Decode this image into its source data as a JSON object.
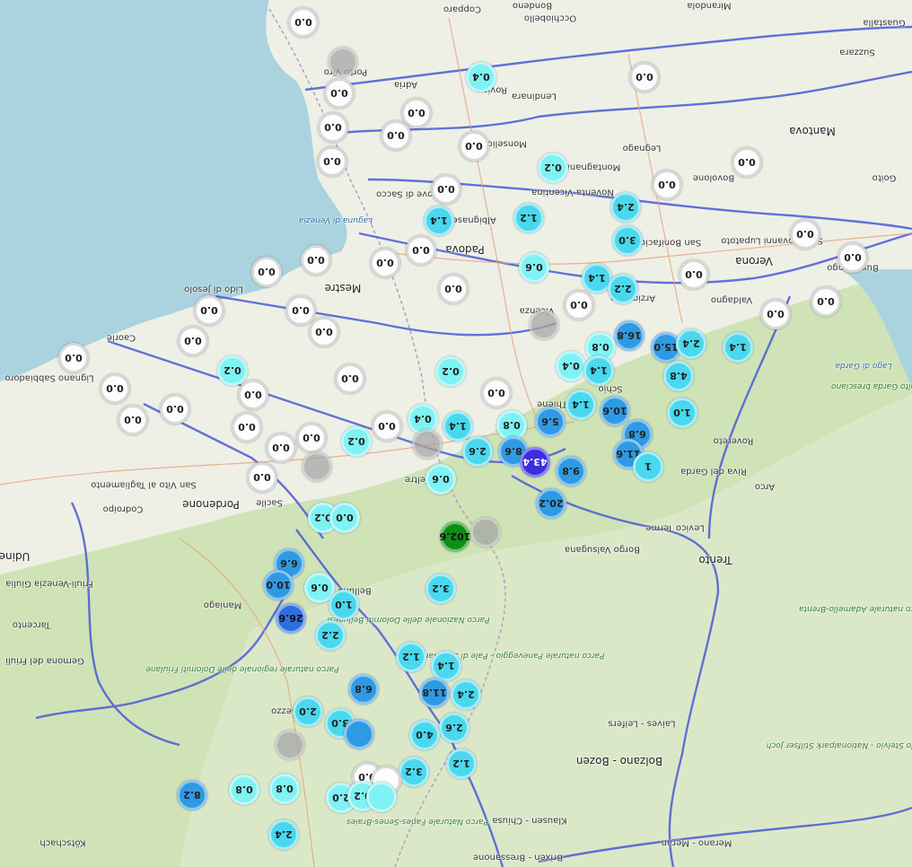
{
  "map": {
    "place_labels": [
      {
        "text": "Copparo",
        "big": false
      },
      {
        "text": "Bondeno",
        "big": false
      },
      {
        "text": "Mirandola",
        "big": false
      },
      {
        "text": "Occhiobello",
        "big": false
      },
      {
        "text": "Guastalla",
        "big": false
      },
      {
        "text": "Suzzara",
        "big": false
      },
      {
        "text": "Porto Viro",
        "big": false
      },
      {
        "text": "Adria",
        "big": false
      },
      {
        "text": "Rovigo",
        "big": false
      },
      {
        "text": "Lendinara",
        "big": false
      },
      {
        "text": "Mantova",
        "big": true
      },
      {
        "text": "Legnago",
        "big": false
      },
      {
        "text": "Monselice",
        "big": false
      },
      {
        "text": "Montagnana",
        "big": false
      },
      {
        "text": "Bovolone",
        "big": false
      },
      {
        "text": "Goito",
        "big": false
      },
      {
        "text": "Piove di Sacco",
        "big": false
      },
      {
        "text": "Noventa Vicentina",
        "big": false
      },
      {
        "text": "Albignasego",
        "big": false
      },
      {
        "text": "San Bonifacio",
        "big": false
      },
      {
        "text": "San Giovanni Lupatoto",
        "big": false
      },
      {
        "text": "Padova",
        "big": true
      },
      {
        "text": "Verona",
        "big": true
      },
      {
        "text": "Bussolengo",
        "big": false
      },
      {
        "text": "Lido di Jesolo",
        "big": false
      },
      {
        "text": "Mestre",
        "big": true
      },
      {
        "text": "Vicenza",
        "big": false
      },
      {
        "text": "Arzignano",
        "big": false
      },
      {
        "text": "Valdagno",
        "big": false
      },
      {
        "text": "Schio",
        "big": false
      },
      {
        "text": "Thiene",
        "big": false
      },
      {
        "text": "Rovereto",
        "big": false
      },
      {
        "text": "Riva del Garda",
        "big": false
      },
      {
        "text": "Arco",
        "big": false
      },
      {
        "text": "Pordenone",
        "big": true
      },
      {
        "text": "Udine",
        "big": true
      },
      {
        "text": "Codroipo",
        "big": false
      },
      {
        "text": "San Vito al Tagliamento",
        "big": false
      },
      {
        "text": "Lignano Sabbiadoro",
        "big": false
      },
      {
        "text": "Caorle",
        "big": false
      },
      {
        "text": "Sacile",
        "big": false
      },
      {
        "text": "Feltre",
        "big": false
      },
      {
        "text": "Belluno",
        "big": false
      },
      {
        "text": "Levico Terme",
        "big": false
      },
      {
        "text": "Borgo Valsugana",
        "big": false
      },
      {
        "text": "Trento",
        "big": true
      },
      {
        "text": "Bolzano - Bozen",
        "big": true
      },
      {
        "text": "Laives - Leifers",
        "big": false
      },
      {
        "text": "Merano - Meran",
        "big": false
      },
      {
        "text": "Klausen - Chiusa",
        "big": false
      },
      {
        "text": "Brixen - Bressanone",
        "big": false
      },
      {
        "text": "Tolmezzo",
        "big": false
      },
      {
        "text": "Gemona del Friuli",
        "big": false
      },
      {
        "text": "Tarcento",
        "big": false
      },
      {
        "text": "Maniago",
        "big": false
      },
      {
        "text": "Friuli-Venezia Giulia",
        "big": false
      },
      {
        "text": "Kötschach",
        "big": false
      }
    ],
    "park_labels": [
      "Parco Nazionale delle Dolomiti Bellunesi",
      "Parco naturale regionale delle Dolomiti Friulane",
      "Parco naturale Paneveggio - Pale di San Martino",
      "Parco Naturale Fanes-Senes-Braies",
      "Parco naturale Adamello-Brenta",
      "Parco Nazionale dello Stelvio - Nationalpark Stilfser Joch",
      "Parco alto Garda bresciano"
    ],
    "water_labels": [
      "Laguna di Venezia",
      "Lago di Garda"
    ],
    "markers": [
      {
        "value": "0.0",
        "level": "zero"
      },
      {
        "value": "0.4",
        "level": "low"
      },
      {
        "value": "0.0",
        "level": "zero"
      },
      {
        "value": "",
        "level": "grey"
      },
      {
        "value": "0.0",
        "level": "zero"
      },
      {
        "value": "0.0",
        "level": "zero"
      },
      {
        "value": "0.0",
        "level": "zero"
      },
      {
        "value": "0.0",
        "level": "zero"
      },
      {
        "value": "0.0",
        "level": "zero"
      },
      {
        "value": "0.2",
        "level": "low"
      },
      {
        "value": "0.0",
        "level": "zero"
      },
      {
        "value": "0.0",
        "level": "zero"
      },
      {
        "value": "0.0",
        "level": "zero"
      },
      {
        "value": "0.0",
        "level": "zero"
      },
      {
        "value": "1.2",
        "level": "mid"
      },
      {
        "value": "2.4",
        "level": "mid"
      },
      {
        "value": "1.4",
        "level": "mid"
      },
      {
        "value": "0.0",
        "level": "zero"
      },
      {
        "value": "3.0",
        "level": "mid"
      },
      {
        "value": "0.0",
        "level": "zero"
      },
      {
        "value": "0.0",
        "level": "zero"
      },
      {
        "value": "0.0",
        "level": "zero"
      },
      {
        "value": "0.0",
        "level": "zero"
      },
      {
        "value": "0.0",
        "level": "zero"
      },
      {
        "value": "0.6",
        "level": "low"
      },
      {
        "value": "0.0",
        "level": "zero"
      },
      {
        "value": "1.4",
        "level": "mid"
      },
      {
        "value": "2.2",
        "level": "mid"
      },
      {
        "value": "0.0",
        "level": "zero"
      },
      {
        "value": "0.0",
        "level": "zero"
      },
      {
        "value": "0.0",
        "level": "zero"
      },
      {
        "value": "0.0",
        "level": "zero"
      },
      {
        "value": "",
        "level": "grey"
      },
      {
        "value": "0.0",
        "level": "zero"
      },
      {
        "value": "0.0",
        "level": "zero"
      },
      {
        "value": "0.0",
        "level": "zero"
      },
      {
        "value": "16.8",
        "level": "high"
      },
      {
        "value": "0.8",
        "level": "low"
      },
      {
        "value": "15.0",
        "level": "high"
      },
      {
        "value": "2.4",
        "level": "mid"
      },
      {
        "value": "1.4",
        "level": "mid"
      },
      {
        "value": "0.0",
        "level": "zero"
      },
      {
        "value": "0.2",
        "level": "low"
      },
      {
        "value": "0.0",
        "level": "zero"
      },
      {
        "value": "0.2",
        "level": "low"
      },
      {
        "value": "0.0",
        "level": "zero"
      },
      {
        "value": "0.4",
        "level": "low"
      },
      {
        "value": "1.4",
        "level": "mid"
      },
      {
        "value": "4.8",
        "level": "mid"
      },
      {
        "value": "0.0",
        "level": "zero"
      },
      {
        "value": "0.0",
        "level": "zero"
      },
      {
        "value": "0.0",
        "level": "zero"
      },
      {
        "value": "1.4",
        "level": "mid"
      },
      {
        "value": "10.6",
        "level": "high"
      },
      {
        "value": "1.0",
        "level": "mid"
      },
      {
        "value": "0.0",
        "level": "zero"
      },
      {
        "value": "0.0",
        "level": "zero"
      },
      {
        "value": "0.4",
        "level": "low"
      },
      {
        "value": "1.4",
        "level": "mid"
      },
      {
        "value": "0.8",
        "level": "low"
      },
      {
        "value": "5.6",
        "level": "high"
      },
      {
        "value": "0.0",
        "level": "zero"
      },
      {
        "value": "0.0",
        "level": "zero"
      },
      {
        "value": "0.2",
        "level": "low"
      },
      {
        "value": "",
        "level": "grey"
      },
      {
        "value": "2.6",
        "level": "mid"
      },
      {
        "value": "8.6",
        "level": "high"
      },
      {
        "value": "43.4",
        "level": "purple"
      },
      {
        "value": "6.8",
        "level": "high"
      },
      {
        "value": "11.6",
        "level": "high"
      },
      {
        "value": "1",
        "level": "mid"
      },
      {
        "value": "0.0",
        "level": "zero"
      },
      {
        "value": "",
        "level": "grey"
      },
      {
        "value": "0.0",
        "level": "zero"
      },
      {
        "value": "9.8",
        "level": "high"
      },
      {
        "value": "0.6",
        "level": "low"
      },
      {
        "value": "0.0",
        "level": "zero"
      },
      {
        "value": "20.2",
        "level": "high"
      },
      {
        "value": "0.2",
        "level": "low"
      },
      {
        "value": "0.0",
        "level": "low"
      },
      {
        "value": "102.6",
        "level": "green"
      },
      {
        "value": "",
        "level": "grey"
      },
      {
        "value": "6.6",
        "level": "high"
      },
      {
        "value": "10.0",
        "level": "high"
      },
      {
        "value": "0.6",
        "level": "low"
      },
      {
        "value": "3.2",
        "level": "mid"
      },
      {
        "value": "1.0",
        "level": "mid"
      },
      {
        "value": "26.6",
        "level": "vhigh"
      },
      {
        "value": "2.2",
        "level": "mid"
      },
      {
        "value": "1.2",
        "level": "mid"
      },
      {
        "value": "1.4",
        "level": "mid"
      },
      {
        "value": "6.8",
        "level": "high"
      },
      {
        "value": "11.8",
        "level": "high"
      },
      {
        "value": "2.4",
        "level": "mid"
      },
      {
        "value": "2.0",
        "level": "mid"
      },
      {
        "value": "3.0",
        "level": "mid"
      },
      {
        "value": "",
        "level": "high"
      },
      {
        "value": "2.6",
        "level": "mid"
      },
      {
        "value": "4.0",
        "level": "mid"
      },
      {
        "value": "",
        "level": "grey"
      },
      {
        "value": "1.2",
        "level": "mid"
      },
      {
        "value": "3.2",
        "level": "mid"
      },
      {
        "value": "0.0",
        "level": "zero"
      },
      {
        "value": "",
        "level": "zero"
      },
      {
        "value": "8.2",
        "level": "high"
      },
      {
        "value": "0.8",
        "level": "low"
      },
      {
        "value": "0.8",
        "level": "low"
      },
      {
        "value": "2.0",
        "level": "low"
      },
      {
        "value": "0.2",
        "level": "low"
      },
      {
        "value": "",
        "level": "low"
      },
      {
        "value": "2.4",
        "level": "mid"
      }
    ]
  }
}
